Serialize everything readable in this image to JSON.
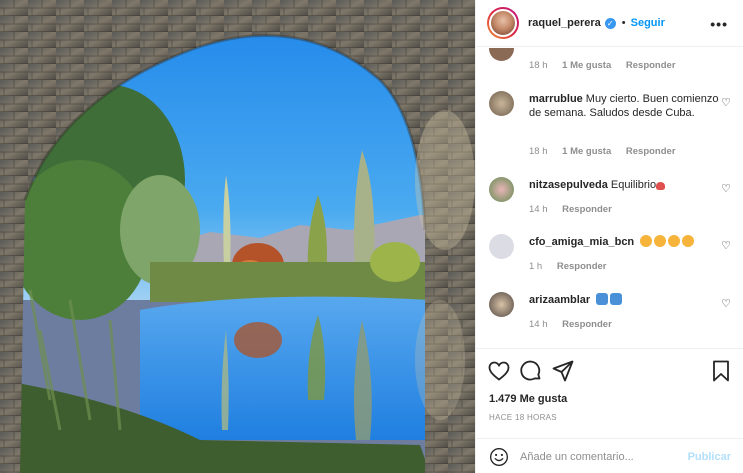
{
  "header": {
    "username": "raquel_perera",
    "dot": "•",
    "follow_label": "Seguir",
    "more_label": "•••"
  },
  "comments": [
    {
      "user": "",
      "text": "",
      "time": "18 h",
      "likes": "1 Me gusta",
      "reply": "Responder",
      "avatar_color": "#8a6a55"
    },
    {
      "user": "marrublue",
      "text": "Muy cierto. Buen comienzo de semana. Saludos desde Cuba.",
      "time": "18 h",
      "likes": "1 Me gusta",
      "reply": "Responder",
      "avatar_color": "#9a8d7b"
    },
    {
      "user": "nitzasepulveda",
      "text": "Equilibrio",
      "time": "14 h",
      "likes": "",
      "reply": "Responder",
      "avatar_color": "#7a9a68"
    },
    {
      "user": "cfo_amiga_mia_bcn",
      "text": "",
      "time": "1 h",
      "likes": "",
      "reply": "Responder",
      "avatar_color": "#d7d7df"
    },
    {
      "user": "arizaamblar",
      "text": "",
      "time": "14 h",
      "likes": "",
      "reply": "Responder",
      "avatar_color": "#6e6258"
    }
  ],
  "icons": {
    "like": "heart-icon",
    "comment": "speech-bubble-icon",
    "share": "paper-plane-icon",
    "save": "bookmark-icon",
    "emoji": "smiley-icon",
    "verified": "verified-badge-icon",
    "comment_like": "heart-icon"
  },
  "likes_label": "1.479 Me gusta",
  "time_ago": "HACE 18 HORAS",
  "composer": {
    "placeholder": "Añade un comentario...",
    "publish_label": "Publicar"
  },
  "colors": {
    "follow": "#0095f6",
    "verified": "#3897f0",
    "publish_disabled": "#b2dffc",
    "meta_gray": "#8e8e8e",
    "sky": "#2d8ee8"
  }
}
